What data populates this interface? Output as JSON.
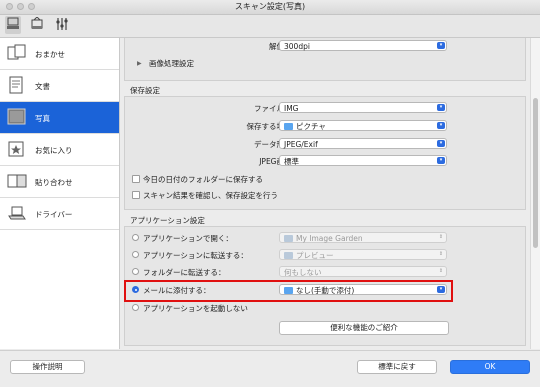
{
  "window": {
    "title": "スキャン設定(写真)"
  },
  "toolbar": {
    "icons": [
      "scan-from-computer-icon",
      "scan-from-operation-panel-icon",
      "general-settings-icon"
    ]
  },
  "sidebar": {
    "items": [
      {
        "label": "おまかせ",
        "icon": "auto-scan-icon"
      },
      {
        "label": "文書",
        "icon": "document-icon"
      },
      {
        "label": "写真",
        "icon": "photo-icon",
        "selected": true
      },
      {
        "label": "お気に入り",
        "icon": "favorites-icon"
      },
      {
        "label": "貼り合わせ",
        "icon": "stitch-icon"
      },
      {
        "label": "ドライバー",
        "icon": "driver-icon"
      }
    ]
  },
  "scan_options": {
    "resolution_label": "解像度：",
    "resolution_value": "300dpi",
    "image_processing_label": "画像処理設定"
  },
  "save_settings": {
    "title": "保存設定",
    "filename_label": "ファイル名：",
    "filename_value": "IMG",
    "save_in_label": "保存する場所：",
    "save_in_value": "ピクチャ",
    "data_format_label": "データ形式：",
    "data_format_value": "JPEG/Exif",
    "jpeg_quality_label": "JPEG画質：",
    "jpeg_quality_value": "標準",
    "checkbox_subfolder": "今日の日付のフォルダーに保存する",
    "checkbox_check_result": "スキャン結果を確認し、保存設定を行う"
  },
  "app_settings": {
    "title": "アプリケーション設定",
    "options": [
      {
        "label": "アプリケーションで開く：",
        "value": "My Image Garden",
        "selected": false
      },
      {
        "label": "アプリケーションに転送する：",
        "value": "プレビュー",
        "selected": false
      },
      {
        "label": "フォルダーに転送する：",
        "value": "何もしない",
        "selected": false
      },
      {
        "label": "メールに添付する：",
        "value": "なし(手動で添付)",
        "selected": true
      },
      {
        "label": "アプリケーションを起動しない",
        "value": "",
        "selected": false
      }
    ],
    "more_functions_button": "便利な機能のご紹介"
  },
  "footer": {
    "instructions_button": "操作説明",
    "defaults_button": "標準に戻す",
    "ok_button": "OK"
  },
  "colors": {
    "accent": "#2c6be0",
    "highlight": "#e01010",
    "selected_nav": "#1b63d8"
  }
}
